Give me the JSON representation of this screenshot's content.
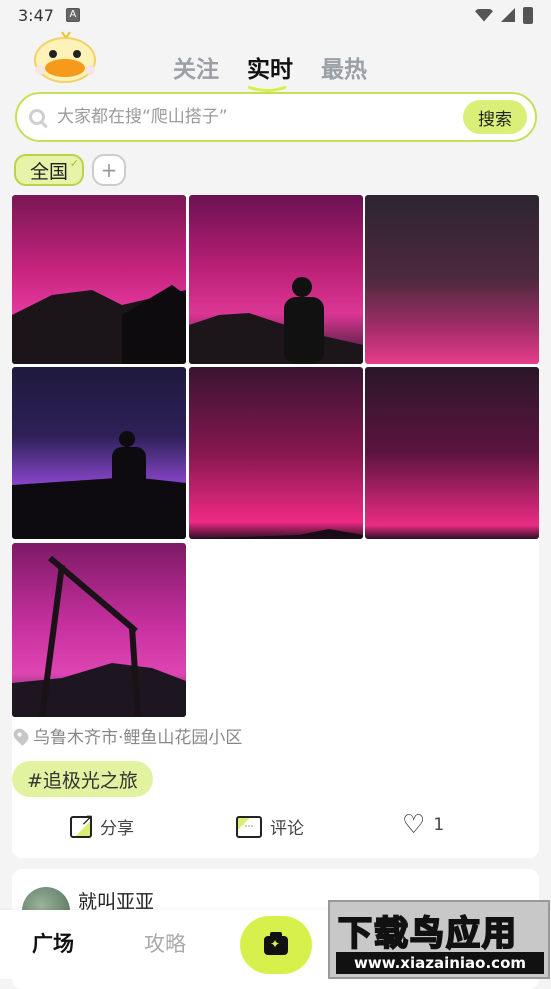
{
  "status": {
    "time": "3:47",
    "a_badge": "A"
  },
  "header": {
    "tabs": [
      {
        "label": "关注",
        "active": false
      },
      {
        "label": "实时",
        "active": true
      },
      {
        "label": "最热",
        "active": false
      }
    ]
  },
  "search": {
    "placeholder": "大家都在搜“爬山搭子”",
    "button": "搜索"
  },
  "regions": {
    "selected": "全国",
    "add": "+"
  },
  "post": {
    "photos": [
      "aurora-mountain",
      "aurora-silhouette",
      "aurora-stars",
      "aurora-purple-silhouette",
      "aurora-pink-glow",
      "aurora-pink-glow-2",
      "aurora-swing"
    ],
    "location": "乌鲁木齐市·鲤鱼山花园小区",
    "tag": "#追极光之旅",
    "actions": {
      "share": "分享",
      "comment": "评论",
      "likes": "1"
    }
  },
  "next_post": {
    "username": "就叫亚亚"
  },
  "nav": {
    "home": "广场",
    "guide": "攻略"
  },
  "watermark": {
    "title": "下载鸟应用",
    "url": "www.xiazainiao.com"
  },
  "colors": {
    "accent": "#d8f04c",
    "chip": "#e1f2a0",
    "border": "#c6df58"
  }
}
